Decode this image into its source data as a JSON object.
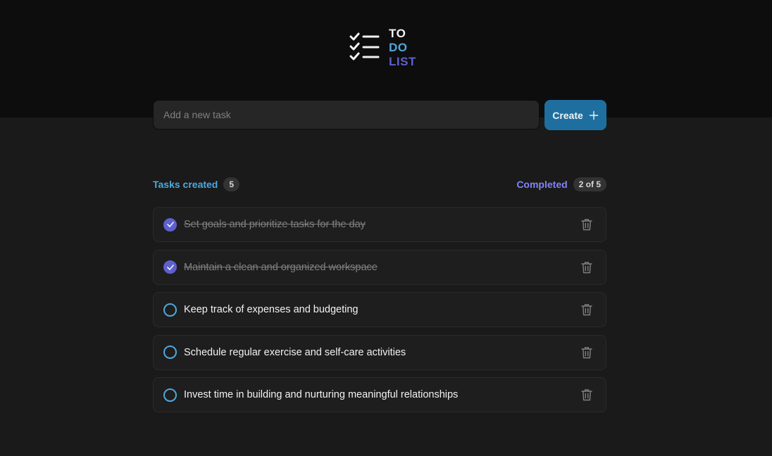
{
  "logo": {
    "line1": "TO",
    "line2": "DO",
    "line3": "LIST"
  },
  "form": {
    "placeholder": "Add a new task",
    "create_label": "Create"
  },
  "counters": {
    "created_label": "Tasks created",
    "created_count": "5",
    "completed_label": "Completed",
    "completed_count": "2 of 5"
  },
  "tasks": [
    {
      "text": "Set goals and prioritize tasks for the day",
      "done": true
    },
    {
      "text": "Maintain a clean and organized workspace",
      "done": true
    },
    {
      "text": "Keep track of expenses and budgeting",
      "done": false
    },
    {
      "text": "Schedule regular exercise and self-care activities",
      "done": false
    },
    {
      "text": "Invest time in building and nurturing meaningful relationships",
      "done": false
    }
  ],
  "colors": {
    "header_bg": "#0d0d0d",
    "page_bg": "#1a1a1a",
    "blue": "#4ea8de",
    "purple": "#5e60ce",
    "purple_light": "#8284fa",
    "button": "#1e6f9f"
  },
  "icons": {
    "logo": "checklist-icon",
    "create": "plus-icon",
    "check": "check-icon",
    "delete": "trash-icon"
  }
}
